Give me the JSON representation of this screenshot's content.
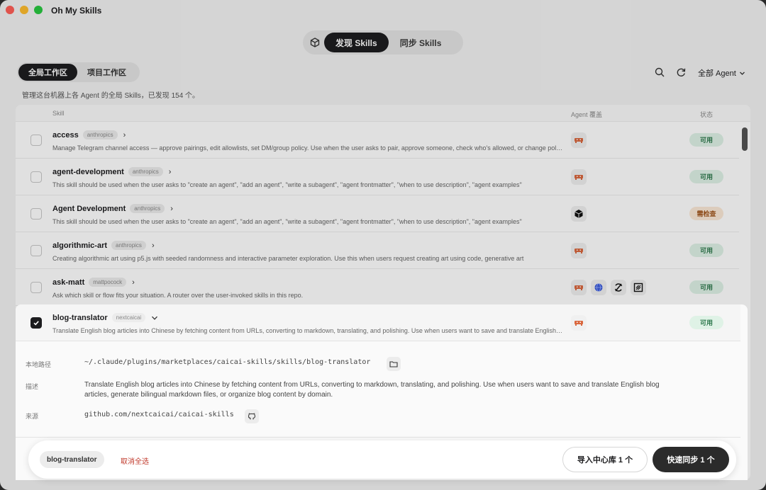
{
  "window": {
    "title": "Oh My Skills"
  },
  "top_tabs": [
    {
      "label": "发现 Skills",
      "active": true
    },
    {
      "label": "同步 Skills",
      "active": false
    }
  ],
  "scope_tabs": [
    {
      "label": "全局工作区",
      "active": true
    },
    {
      "label": "项目工作区",
      "active": false
    }
  ],
  "toolbar": {
    "agent_filter": "全部 Agent",
    "search_icon": "search-icon",
    "refresh_icon": "refresh-icon"
  },
  "subtitle": "管理这台机器上各 Agent 的全局 Skills，已发现 154 个。",
  "table": {
    "headers": {
      "skill": "Skill",
      "agents": "Agent 覆盖",
      "status": "状态"
    },
    "rows": [
      {
        "name": "access",
        "tag": "anthropics",
        "desc": "Manage Telegram channel access — approve pairings, edit allowlists, set DM/group policy. Use when the user asks to pair, approve someone, check who's allowed, or change policy.",
        "status": "可用",
        "agents": [
          "claude-icon"
        ]
      },
      {
        "name": "agent-development",
        "tag": "anthropics",
        "desc": "This skill should be used when the user asks to \"create an agent\", \"add an agent\", \"write a subagent\", \"agent frontmatter\", \"when to use description\", \"agent examples\"",
        "status": "可用",
        "agents": [
          "claude-icon"
        ]
      },
      {
        "name": "Agent Development",
        "tag": "anthropics",
        "desc": "This skill should be used when the user asks to \"create an agent\", \"add an agent\", \"write a subagent\", \"agent frontmatter\", \"when to use description\", \"agent examples\"",
        "status": "需检查",
        "agents": [
          "cube-icon"
        ]
      },
      {
        "name": "algorithmic-art",
        "tag": "anthropics",
        "desc": "Creating algorithmic art using p5.js with seeded randomness and interactive parameter exploration. Use this when users request creating art using code, generative art",
        "status": "可用",
        "agents": [
          "claude-icon"
        ]
      },
      {
        "name": "ask-matt",
        "tag": "mattpocock",
        "desc": "Ask which skill or flow fits your situation. A router over the user-invoked skills in this repo.",
        "status": "可用",
        "agents": [
          "claude-icon",
          "globe-icon",
          "sync-icon",
          "frame-icon"
        ]
      },
      {
        "name": "blog-translator",
        "tag": "nextcaicai",
        "desc": "Translate English blog articles into Chinese by fetching content from URLs, converting to markdown, translating, and polishing. Use when users want to save and translate English blog articles",
        "status": "可用",
        "agents": [
          "claude-icon"
        ],
        "selected": true
      }
    ]
  },
  "detail": {
    "path_label": "本地路径",
    "path": "~/.claude/plugins/marketplaces/caicai-skills/skills/blog-translator",
    "desc_label": "描述",
    "desc_line1": "Translate English blog articles into Chinese by fetching content from URLs, converting to markdown, translating, and polishing. Use when users want to save and translate English blog",
    "desc_line2": "articles, generate bilingual markdown files, or organize blog content by domain.",
    "source_label": "来源",
    "source": "github.com/nextcaicai/caicai-skills"
  },
  "selection_bar": {
    "chip": "blog-translator",
    "deselect": "取消全选",
    "import": "导入中心库 1 个",
    "sync": "快速同步 1 个"
  },
  "colors": {
    "ok_bg": "#dff2e6",
    "ok_fg": "#2f7a4e",
    "warn_bg": "#fbe9d6",
    "warn_fg": "#a1561d",
    "claude_orange": "#d9673e"
  }
}
